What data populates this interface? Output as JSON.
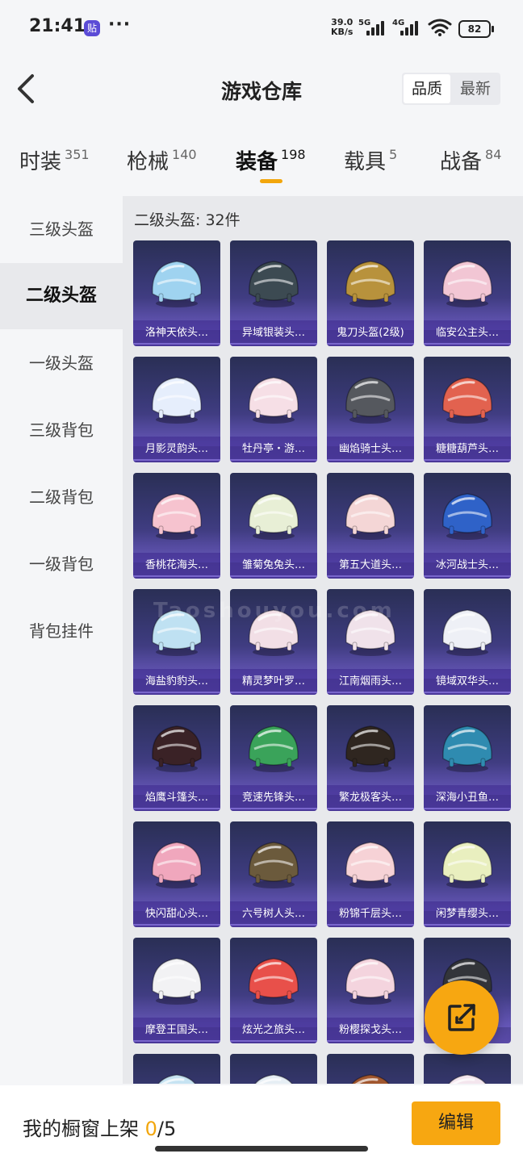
{
  "status_bar": {
    "time": "21:41",
    "app_badge": "贴",
    "more": "···",
    "net_speed_value": "39.0",
    "net_speed_unit": "KB/s",
    "sim1": "5G",
    "sim2": "4G",
    "battery": "82"
  },
  "header": {
    "title": "游戏仓库",
    "sort_options": [
      "品质",
      "最新"
    ]
  },
  "category_tabs": [
    {
      "label": "时装",
      "count": "351"
    },
    {
      "label": "枪械",
      "count": "140"
    },
    {
      "label": "装备",
      "count": "198"
    },
    {
      "label": "载具",
      "count": "5"
    },
    {
      "label": "战备",
      "count": "84"
    }
  ],
  "sidebar": {
    "items": [
      "三级头盔",
      "二级头盔",
      "一级头盔",
      "三级背包",
      "二级背包",
      "一级背包",
      "背包挂件"
    ]
  },
  "content": {
    "sub_header": "二级头盔: 32件",
    "items": [
      {
        "name": "洛神天依头…",
        "color": "#9fd3f0"
      },
      {
        "name": "异域银装头…",
        "color": "#3c4a52"
      },
      {
        "name": "鬼刀头盔(2级)",
        "color": "#b8923c"
      },
      {
        "name": "临安公主头…",
        "color": "#f2c6d4"
      },
      {
        "name": "月影灵韵头…",
        "color": "#e6eefc"
      },
      {
        "name": "牡丹亭・游…",
        "color": "#f6dfe6"
      },
      {
        "name": "幽焰骑士头…",
        "color": "#55585e"
      },
      {
        "name": "糖糖葫芦头…",
        "color": "#e2624f"
      },
      {
        "name": "香桃花海头…",
        "color": "#f6c3cf"
      },
      {
        "name": "雏菊兔兔头…",
        "color": "#e8efd6"
      },
      {
        "name": "第五大道头…",
        "color": "#f4d6d6"
      },
      {
        "name": "冰河战士头…",
        "color": "#2f62c8"
      },
      {
        "name": "海盐豹豹头…",
        "color": "#bfe1f2"
      },
      {
        "name": "精灵梦叶罗…",
        "color": "#f2dfe6"
      },
      {
        "name": "江南烟雨头…",
        "color": "#f0e2ea"
      },
      {
        "name": "镜域双华头…",
        "color": "#eef0f6"
      },
      {
        "name": "焰鹰斗篷头…",
        "color": "#3a2226"
      },
      {
        "name": "竞速先锋头…",
        "color": "#3aa35a"
      },
      {
        "name": "繁龙极客头…",
        "color": "#2f2620"
      },
      {
        "name": "深海小丑鱼…",
        "color": "#2f8bb0"
      },
      {
        "name": "快闪甜心头…",
        "color": "#f0a7bd"
      },
      {
        "name": "六号树人头…",
        "color": "#6b5a3c"
      },
      {
        "name": "粉锦千层头…",
        "color": "#f6d2d6"
      },
      {
        "name": "闲梦青缨头…",
        "color": "#e9efbf"
      },
      {
        "name": "摩登王国头…",
        "color": "#f2f2f4"
      },
      {
        "name": "炫光之旅头…",
        "color": "#e8504a"
      },
      {
        "name": "粉樱探戈头…",
        "color": "#f4d4de"
      },
      {
        "name": "",
        "color": "#33353a"
      },
      {
        "name": "",
        "color": "#c6e3f2"
      },
      {
        "name": "",
        "color": "#e6eef4"
      },
      {
        "name": "",
        "color": "#a0562e"
      },
      {
        "name": "",
        "color": "#f4e6ee"
      }
    ]
  },
  "bottom_bar": {
    "shelf_label": "我的橱窗上架",
    "shelf_current": "0",
    "shelf_total": "/5",
    "edit_label": "编辑"
  },
  "watermark": "Taoshouyou.com",
  "colors": {
    "accent": "#f7a711",
    "card_top": "#2a2f55",
    "card_bottom": "#5a4aa8"
  }
}
